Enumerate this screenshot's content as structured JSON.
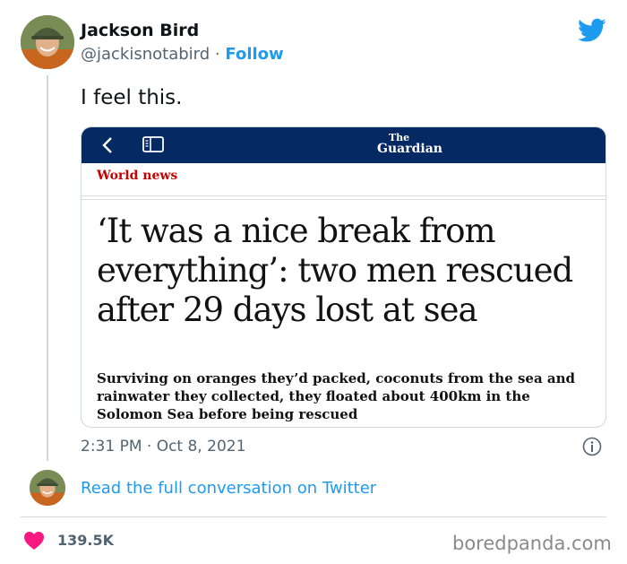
{
  "author": {
    "name": "Jackson Bird",
    "handle": "@jackisnotabird",
    "separator": "·",
    "follow_label": "Follow"
  },
  "tweet": {
    "text": "I feel this.",
    "timestamp": "2:31 PM · Oct 8, 2021"
  },
  "embedded_article": {
    "brand_top": "The",
    "brand_bottom": "Guardian",
    "section": "World news",
    "headline": "‘It was a nice break from everything’: two men rescued after 29 days lost at sea",
    "standfirst": "Surviving on oranges they’d packed, coconuts from the sea and rainwater they collected, they floated about 400km in the Solomon Sea before being rescued"
  },
  "footer": {
    "read_more": "Read the full conversation on Twitter",
    "like_count": "139.5K",
    "watermark": "boredpanda.com"
  },
  "colors": {
    "twitter_blue": "#1d9bf0",
    "guardian_navy": "#052962",
    "guardian_red": "#c70000",
    "heart_pink": "#f91880"
  },
  "icons": [
    "twitter-bird-icon",
    "back-chevron-icon",
    "reader-mode-icon",
    "info-icon",
    "heart-icon"
  ]
}
